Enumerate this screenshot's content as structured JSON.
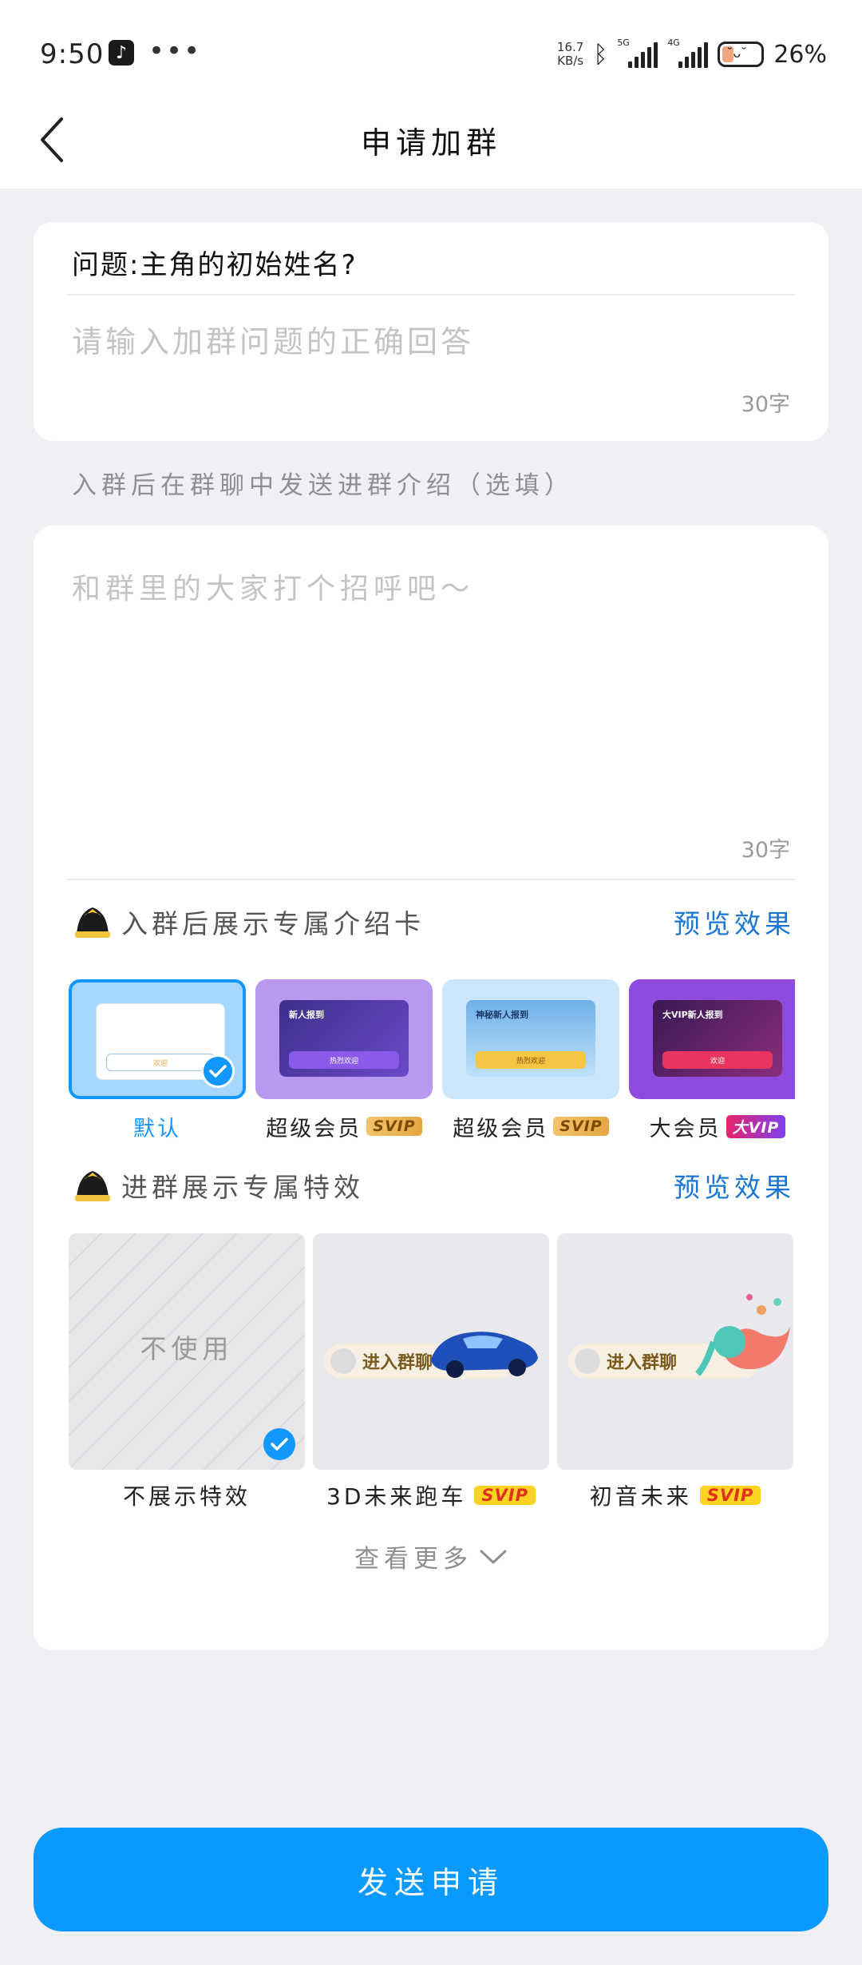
{
  "status_bar": {
    "time": "9:50",
    "dots": "•••",
    "net_speed_value": "16.7",
    "net_speed_unit": "KB/s",
    "signal1_tag": "5G",
    "signal2_tag": "4G",
    "battery": "26%"
  },
  "nav": {
    "title": "申请加群"
  },
  "question": {
    "text": "问题:主角的初始姓名?",
    "answer_placeholder": "请输入加群问题的正确回答",
    "answer_value": "",
    "counter": "30字"
  },
  "intro": {
    "caption": "入群后在群聊中发送进群介绍（选填）",
    "placeholder": "和群里的大家打个招呼吧～",
    "counter": "30字"
  },
  "card_section": {
    "title": "入群后展示专属介绍卡",
    "preview": "预览效果",
    "items": [
      {
        "label": "默认",
        "badge": "",
        "mini_btn": "欢迎",
        "mini_head": ""
      },
      {
        "label": "超级会员",
        "badge": "SVIP",
        "mini_btn": "热烈欢迎",
        "mini_head": "新人报到"
      },
      {
        "label": "超级会员",
        "badge": "SVIP",
        "mini_btn": "热烈欢迎",
        "mini_head": "神秘新人报到"
      },
      {
        "label": "大会员",
        "badge": "大VIP",
        "mini_btn": "欢迎",
        "mini_head": "大VIP新人报到"
      }
    ]
  },
  "effect_section": {
    "title": "进群展示专属特效",
    "preview": "预览效果",
    "items": [
      {
        "label": "不展示特效",
        "thumb_text": "不使用",
        "badge": ""
      },
      {
        "label": "3D未来跑车",
        "pill_text": "进入群聊",
        "badge": "SVIP"
      },
      {
        "label": "初音未来",
        "pill_text": "进入群聊",
        "badge": "SVIP"
      }
    ]
  },
  "see_more": "查看更多",
  "submit": "发送申请",
  "colors": {
    "accent": "#0a99ff",
    "link": "#1a76d2",
    "background": "#efeff4"
  }
}
